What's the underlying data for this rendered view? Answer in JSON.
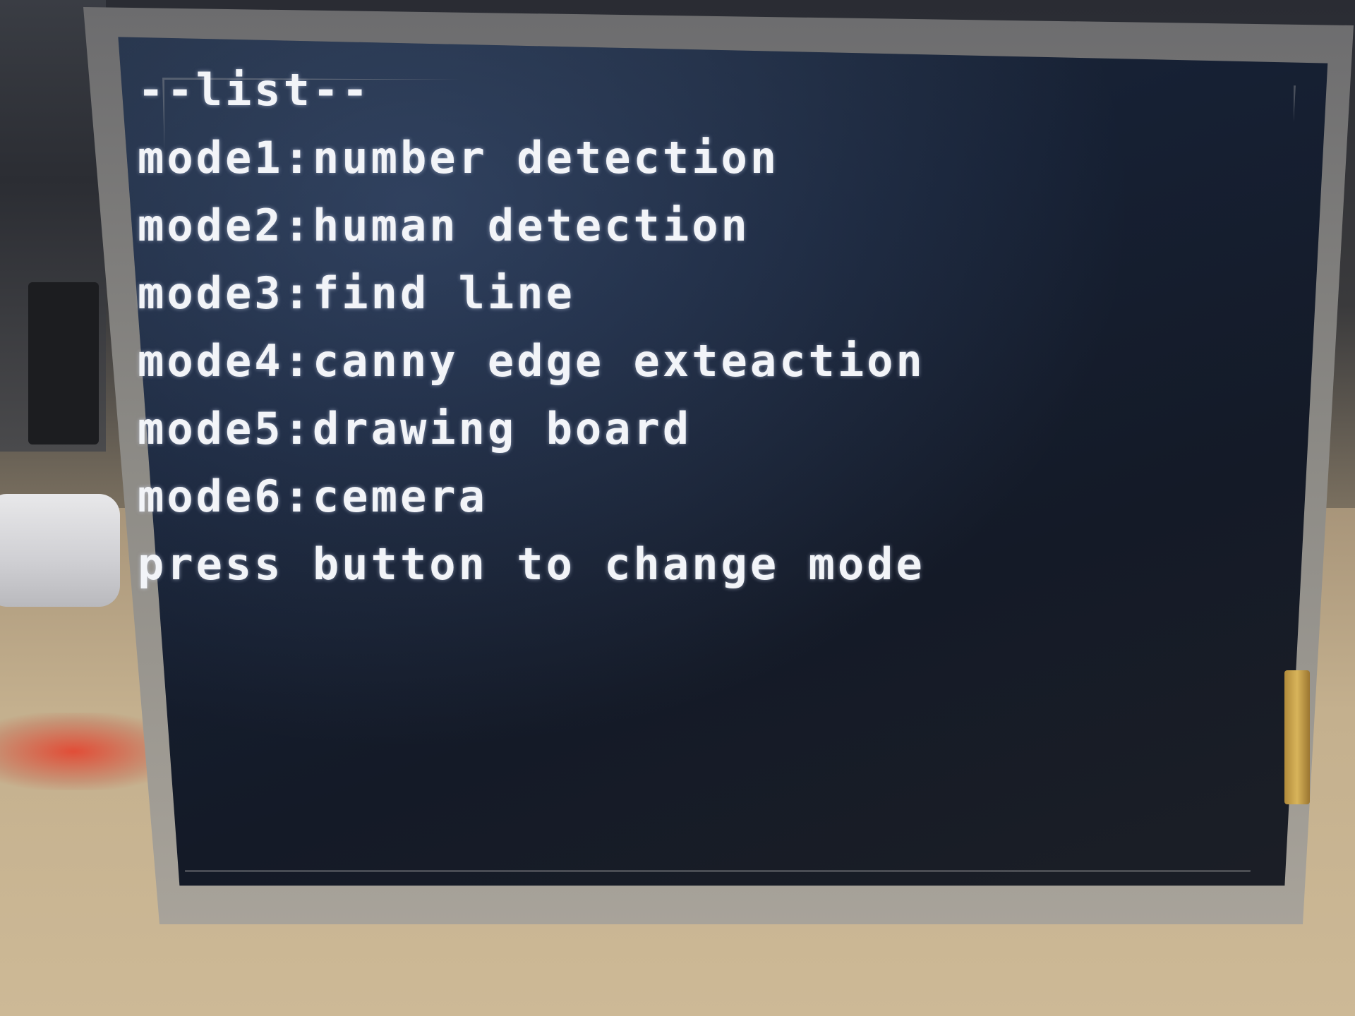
{
  "screen": {
    "title": "--list--",
    "modes": [
      "mode1:number detection",
      "mode2:human detection",
      "mode3:find line",
      "mode4:canny edge exteaction",
      "mode5:drawing board",
      "mode6:cemera"
    ],
    "instruction": "press button to change mode"
  },
  "colors": {
    "screen_background": "#162033",
    "text": "#f2f4f8",
    "bezel": "#8d8b86"
  }
}
